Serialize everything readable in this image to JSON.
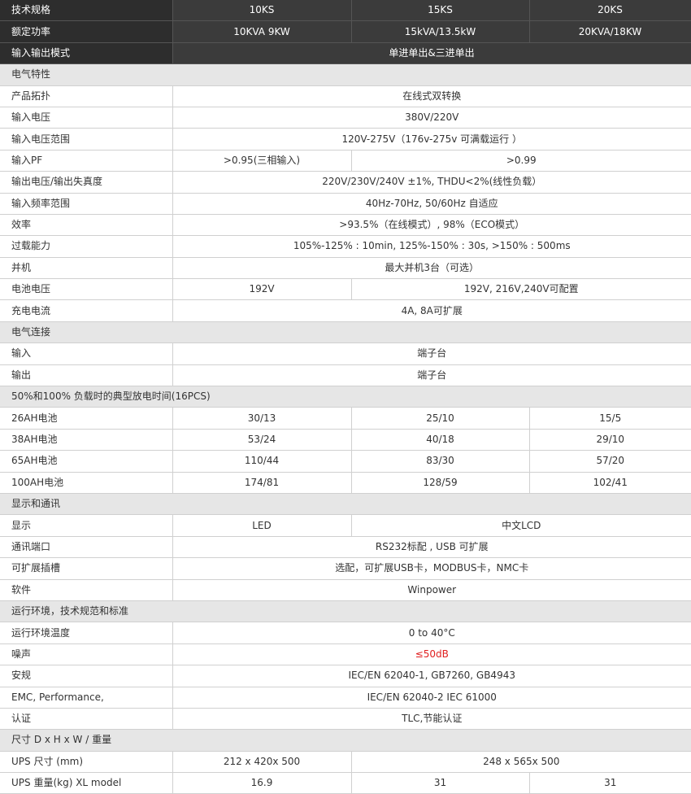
{
  "header": [
    [
      "技术规格",
      "10KS",
      "15KS",
      "20KS"
    ],
    [
      "额定功率",
      "10KVA 9KW",
      "15kVA/13.5kW",
      "20KVA/18KW"
    ],
    [
      "输入输出模式",
      "单进单出&三进单出"
    ]
  ],
  "sections": {
    "electrical": {
      "title": "电气特性",
      "rows": [
        [
          "产品拓扑",
          "在线式双转换"
        ],
        [
          "输入电压",
          "380V/220V"
        ],
        [
          "输入电压范围",
          "120V-275V（176v-275v 可满载运行 ）"
        ],
        [
          "输入PF",
          ">0.95(三相输入)",
          ">0.99"
        ],
        [
          "输出电压/输出失真度",
          "220V/230V/240V ±1%, THDU<2%(线性负载）"
        ],
        [
          "输入频率范围",
          "40Hz-70Hz, 50/60Hz 自适应"
        ],
        [
          "效率",
          ">93.5%（在线模式）, 98%（ECO模式）"
        ],
        [
          "过载能力",
          "105%-125% : 10min, 125%-150% : 30s, >150% : 500ms"
        ],
        [
          "并机",
          "最大并机3台（可选）"
        ],
        [
          "电池电压",
          "192V",
          "192V, 216V,240V可配置"
        ],
        [
          "充电电流",
          "4A, 8A可扩展"
        ]
      ]
    },
    "connection": {
      "title": "电气连接",
      "rows": [
        [
          "输入",
          "端子台"
        ],
        [
          "输出",
          "端子台"
        ]
      ]
    },
    "backup": {
      "title": "50%和100% 负载时的典型放电时间(16PCS)",
      "rows": [
        [
          "26AH电池",
          "30/13",
          "25/10",
          "15/5"
        ],
        [
          "38AH电池",
          "53/24",
          "40/18",
          "29/10"
        ],
        [
          "65AH电池",
          "110/44",
          "83/30",
          "57/20"
        ],
        [
          "100AH电池",
          "174/81",
          "128/59",
          "102/41"
        ]
      ]
    },
    "display": {
      "title": "显示和通讯",
      "rows": [
        [
          "显示",
          "LED",
          "中文LCD"
        ],
        [
          "通讯端口",
          "RS232标配 , USB 可扩展"
        ],
        [
          "可扩展插槽",
          "选配，可扩展USB卡，MODBUS卡，NMC卡"
        ],
        [
          "软件",
          "Winpower"
        ]
      ]
    },
    "environment": {
      "title": "运行环境，技术规范和标准",
      "rows": [
        [
          "运行环境温度",
          "0 to 40°C"
        ],
        [
          "噪声",
          "≤50dB"
        ],
        [
          "安规",
          "IEC/EN 62040-1, GB7260, GB4943"
        ],
        [
          "EMC, Performance,",
          "IEC/EN 62040-2  IEC 61000"
        ],
        [
          "认证",
          "TLC,节能认证"
        ]
      ]
    },
    "dimensions": {
      "title": "尺寸 D x H x W / 重量",
      "rows": [
        [
          "UPS 尺寸 (mm)",
          "212 x 420x 500",
          "248 x 565x 500"
        ],
        [
          "UPS 重量(kg) XL model",
          "16.9",
          "31",
          "31"
        ]
      ]
    }
  },
  "colors": {
    "header_bg": "#3b3b3b",
    "section_bg": "#e6e6e6",
    "highlight": "#e02020"
  }
}
